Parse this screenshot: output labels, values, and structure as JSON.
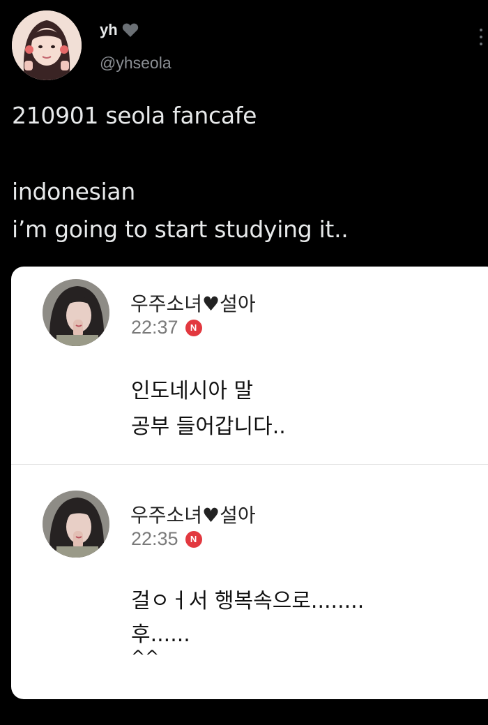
{
  "tweet": {
    "display_name": "yh",
    "handle": "@yhseola",
    "text_lines": [
      "210901 seola fancafe",
      "indonesian",
      "i’m going to start studying it.."
    ]
  },
  "colors": {
    "background": "#000000",
    "text_primary": "#e7e9ea",
    "text_secondary": "#8b8f94",
    "card_background": "#ffffff",
    "badge_red": "#e2383f"
  },
  "icons": {
    "verified_heart": "heart-icon",
    "more": "more-vertical-icon",
    "badge": "n-badge-icon"
  },
  "card": {
    "posts": [
      {
        "author": "우주소녀♥설아",
        "time": "22:37",
        "badge": "N",
        "body_lines": [
          "인도네시아 말",
          "공부 들어갑니다.."
        ]
      },
      {
        "author": "우주소녀♥설아",
        "time": "22:35",
        "badge": "N",
        "body_lines": [
          "걸ㅇㅓ서 행복속으로........",
          "후......",
          "^^"
        ]
      }
    ]
  }
}
